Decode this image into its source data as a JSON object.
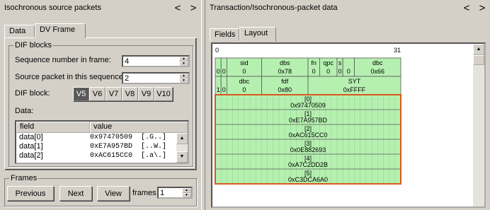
{
  "left": {
    "title": "Isochronous source packets",
    "nav_prev": "<",
    "nav_next": ">",
    "tabs": [
      "Data",
      "DV Frame"
    ],
    "dif_blocks": {
      "legend": "DIF blocks",
      "seq_label": "Sequence number in frame:",
      "seq_value": "4",
      "src_label": "Source packet in this sequence:",
      "src_value": "2",
      "block_label": "DIF block:",
      "blocks": [
        "V5",
        "V6",
        "V7",
        "V8",
        "V9",
        "V10"
      ],
      "selected_block": "V5",
      "data_label": "Data:",
      "columns": [
        "field",
        "value"
      ],
      "rows": [
        {
          "field": "data[0]",
          "value": "0x97470509  [.G..]"
        },
        {
          "field": "data[1]",
          "value": "0xE7A957BD  [..W.]"
        },
        {
          "field": "data[2]",
          "value": "0xAC615CC0  [.a\\.]"
        }
      ]
    },
    "frames": {
      "legend": "Frames",
      "previous": "Previous",
      "next": "Next",
      "view": "View",
      "frames_label": "frames",
      "frames_value": "1"
    }
  },
  "right": {
    "title": "Transaction/Isochronous-packet data",
    "nav_prev": "<",
    "nav_next": ">",
    "tabs": [
      "Fields",
      "Layout"
    ],
    "layout": {
      "bit_start": "0",
      "bit_end": "31",
      "header_rows": [
        [
          {
            "label": "",
            "value": "0"
          },
          {
            "label": "",
            "value": "0"
          },
          {
            "label": "sid",
            "value": "0"
          },
          {
            "label": "dbs",
            "value": "0x78"
          },
          {
            "label": "fn",
            "value": "0"
          },
          {
            "label": "qpc",
            "value": "0"
          },
          {
            "label": "s",
            "value": "0"
          },
          {
            "label": "",
            "value": "0"
          },
          {
            "label": "dbc",
            "value": "0x66"
          }
        ],
        [
          {
            "label": "",
            "value": "1"
          },
          {
            "label": "",
            "value": "0"
          },
          {
            "label": "dbc",
            "value": "0"
          },
          {
            "label": "fdf",
            "value": "0x80"
          },
          {
            "label": "SYT",
            "value": "0xFFFF"
          }
        ]
      ],
      "data_words": [
        {
          "index": "[0]",
          "value": "0x97470509"
        },
        {
          "index": "[1]",
          "value": "0xE7A957BD"
        },
        {
          "index": "[2]",
          "value": "0xAC615CC0"
        },
        {
          "index": "[3]",
          "value": "0x0E882693"
        },
        {
          "index": "[4]",
          "value": "0xA7C2DD2B"
        },
        {
          "index": "[5]",
          "value": "0xC3DCA6A0"
        }
      ]
    }
  },
  "colors": {
    "cell_green": "#b6f0b1",
    "cell_grid": "#8fd98a",
    "data_border": "#d8591d",
    "selected_button": "#5a5a5a"
  }
}
